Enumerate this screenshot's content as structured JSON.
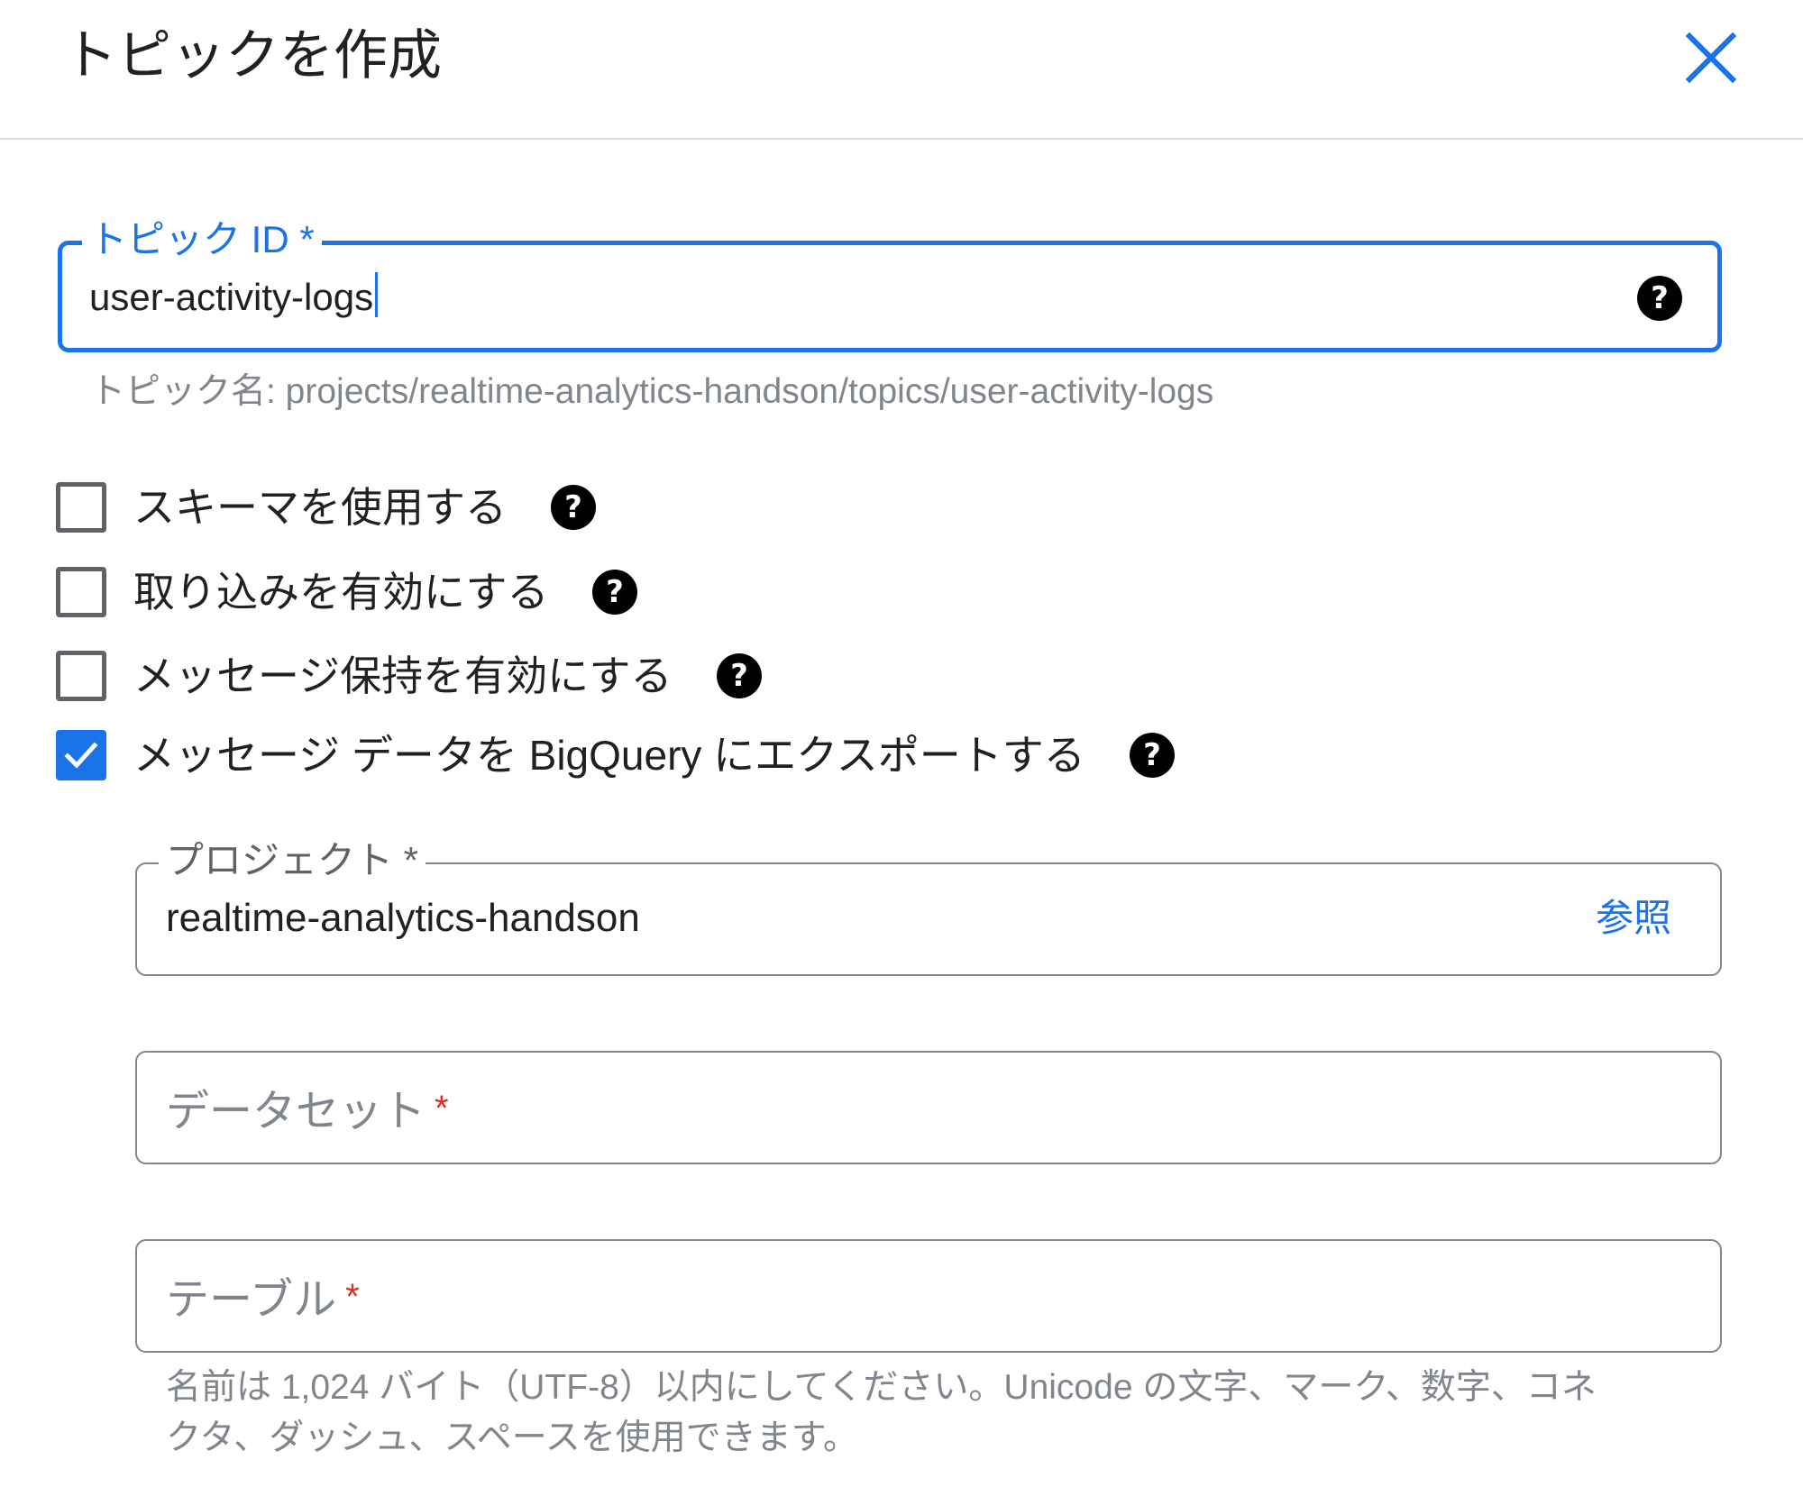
{
  "dialog": {
    "title": "トピックを作成",
    "close_icon": "close-icon",
    "accent_color": "#1a73e8"
  },
  "topic_id": {
    "label": "トピック ID *",
    "value": "user-activity-logs",
    "help_icon": "help-icon",
    "hint": "トピック名: projects/realtime-analytics-handson/topics/user-activity-logs"
  },
  "options": [
    {
      "label": "スキーマを使用する",
      "checked": false
    },
    {
      "label": "取り込みを有効にする",
      "checked": false
    },
    {
      "label": "メッセージ保持を有効にする",
      "checked": false
    },
    {
      "label": "メッセージ データを BigQuery にエクスポートする",
      "checked": true
    }
  ],
  "bigquery": {
    "project": {
      "label": "プロジェクト *",
      "value": "realtime-analytics-handson",
      "browse_label": "参照"
    },
    "dataset": {
      "placeholder": "データセット",
      "required_mark": "*"
    },
    "table": {
      "placeholder": "テーブル",
      "required_mark": "*",
      "hint": "名前は 1,024 バイト（UTF-8）以内にしてください。Unicode の文字、マーク、数字、コネクタ、ダッシュ、スペースを使用できます。"
    }
  }
}
